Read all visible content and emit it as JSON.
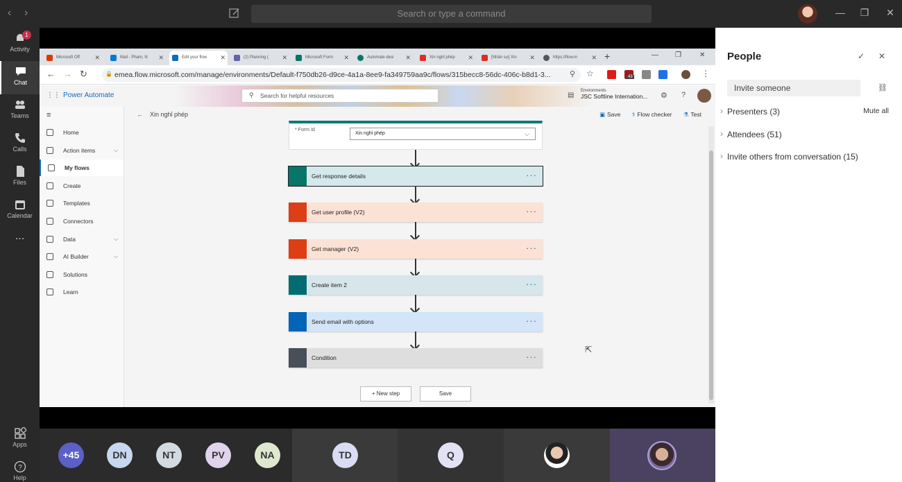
{
  "teams": {
    "search_placeholder": "Search or type a command",
    "rail": [
      {
        "label": "Activity",
        "icon": "bell-icon",
        "badge": "1"
      },
      {
        "label": "Chat",
        "icon": "chat-icon"
      },
      {
        "label": "Teams",
        "icon": "teams-icon"
      },
      {
        "label": "Calls",
        "icon": "phone-icon"
      },
      {
        "label": "Files",
        "icon": "file-icon"
      },
      {
        "label": "Calendar",
        "icon": "calendar-icon"
      },
      {
        "label": "...",
        "icon": "more-icon"
      },
      {
        "label": "Apps",
        "icon": "apps-icon"
      },
      {
        "label": "Help",
        "icon": "help-icon"
      }
    ]
  },
  "browser": {
    "tabs": [
      {
        "label": "Microsoft Off",
        "color": "#d83b01"
      },
      {
        "label": "Mail - Pham, N",
        "color": "#0078d4"
      },
      {
        "label": "Edit your flow",
        "color": "#0f6cbd"
      },
      {
        "label": "(2) Planning (",
        "color": "#6264a7"
      },
      {
        "label": "Microsoft Form",
        "color": "#077568"
      },
      {
        "label": "Automate desi",
        "color": "#077568"
      },
      {
        "label": "Xin nghỉ phép",
        "color": "#d93025"
      },
      {
        "label": "[Nhân sự] Xin",
        "color": "#d93025"
      },
      {
        "label": "https://flow.m",
        "color": "#555555"
      }
    ],
    "url": "emea.flow.microsoft.com/manage/environments/Default-f750db26-d9ce-4a1a-8ee9-fa349759aa9c/flows/315becc8-56dc-406c-b8d1-3...",
    "ext_badge": "43"
  },
  "pa": {
    "title": "Power Automate",
    "search": "Search for helpful resources",
    "env_label": "Environments",
    "env_name": "JSC Softline Internation...",
    "nav": [
      {
        "label": "Home"
      },
      {
        "label": "Action items",
        "chevron": "⌵"
      },
      {
        "label": "My flows"
      },
      {
        "label": "Create"
      },
      {
        "label": "Templates"
      },
      {
        "label": "Connectors"
      },
      {
        "label": "Data",
        "chevron": "⌵"
      },
      {
        "label": "AI Builder",
        "chevron": "⌵"
      },
      {
        "label": "Solutions"
      },
      {
        "label": "Learn"
      }
    ],
    "flow_name": "Xin nghỉ phép",
    "cmd": {
      "save": "Save",
      "checker": "Flow checker",
      "test": "Test"
    },
    "form": {
      "label": "* Form Id",
      "value": "Xin nghỉ phép"
    },
    "steps": [
      {
        "label": "Get response details",
        "bg": "#d5e9ec",
        "icon_bg": "#077568"
      },
      {
        "label": "Get user profile (V2)",
        "bg": "#fce2d5",
        "icon_bg": "#dc3e15"
      },
      {
        "label": "Get manager (V2)",
        "bg": "#fce2d5",
        "icon_bg": "#dc3e15"
      },
      {
        "label": "Create item 2",
        "bg": "#d6e6ea",
        "icon_bg": "#036c70"
      },
      {
        "label": "Send email with options",
        "bg": "#d4e5f7",
        "icon_bg": "#0364b8"
      },
      {
        "label": "Condition",
        "bg": "#dedede",
        "icon_bg": "#484f58"
      }
    ],
    "more": "···",
    "new_step": "+ New step",
    "save": "Save"
  },
  "participants": [
    {
      "initials": "+45",
      "color": "#5b5fc7",
      "text": "#ffffff"
    },
    {
      "initials": "DN",
      "color": "#c7d7f0"
    },
    {
      "initials": "NT",
      "color": "#d3dbe0"
    },
    {
      "initials": "PV",
      "color": "#e0d4ec"
    },
    {
      "initials": "NA",
      "color": "#dfe8cf"
    },
    {
      "initials": "TD",
      "color": "#d9dcf2"
    },
    {
      "initials": "Q",
      "color": "#e3e2f5"
    }
  ],
  "people": {
    "title": "People",
    "invite": "Invite someone",
    "presenters": "Presenters (3)",
    "mute_all": "Mute all",
    "attendees": "Attendees (51)",
    "invite_others": "Invite others from conversation (15)"
  }
}
